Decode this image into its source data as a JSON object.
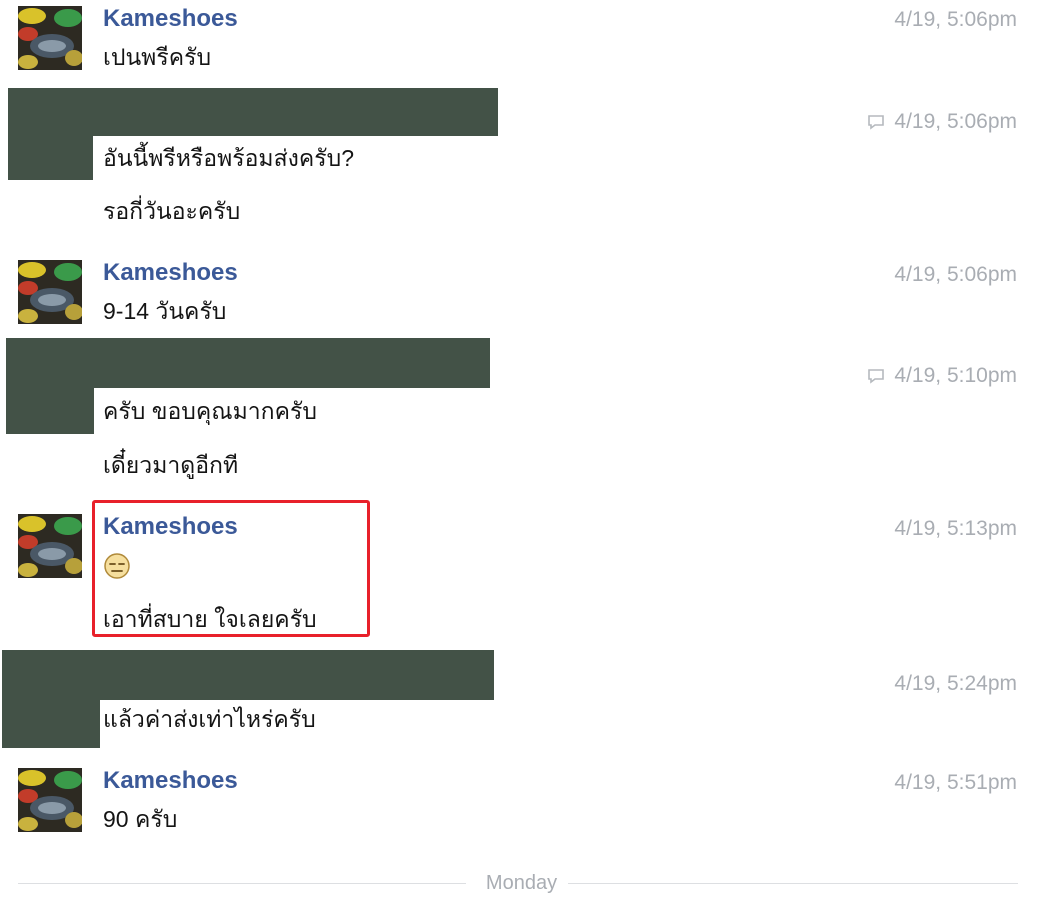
{
  "messages": [
    {
      "sender": "Kameshoes",
      "time": "4/19, 5:06pm",
      "lines": [
        "เปนพรีครับ"
      ]
    },
    {
      "sender": "",
      "time": "4/19, 5:06pm",
      "lines": [
        "อันนี้พรีหรือพร้อมส่งครับ?",
        "รอกี่วันอะครับ"
      ]
    },
    {
      "sender": "Kameshoes",
      "time": "4/19, 5:06pm",
      "lines": [
        "9-14 วันครับ"
      ]
    },
    {
      "sender": "",
      "time": "4/19, 5:10pm",
      "lines": [
        "ครับ ขอบคุณมากครับ",
        "เดี๋ยวมาดูอีกที"
      ]
    },
    {
      "sender": "Kameshoes",
      "time": "4/19, 5:13pm",
      "emoji": "expressionless-face-emoji",
      "lines": [
        "เอาที่สบาย ใจเลยครับ"
      ]
    },
    {
      "sender": "",
      "time": "4/19, 5:24pm",
      "lines": [
        "แล้วค่าส่งเท่าไหร่ครับ"
      ]
    },
    {
      "sender": "Kameshoes",
      "time": "4/19, 5:51pm",
      "lines": [
        "90 ครับ"
      ]
    }
  ],
  "day_divider": "Monday",
  "colors": {
    "sender": "#3b5998",
    "timestamp": "#a9adb3",
    "redaction": "#435247",
    "highlight": "#e8202a"
  }
}
